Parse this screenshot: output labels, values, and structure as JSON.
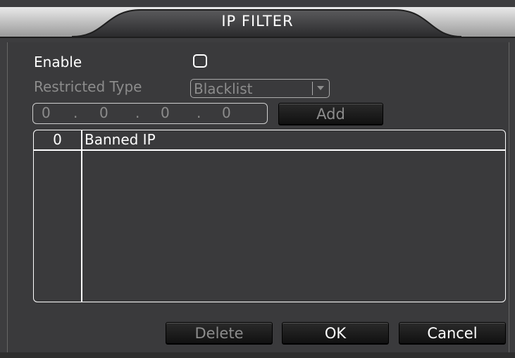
{
  "window": {
    "title": "IP FILTER"
  },
  "form": {
    "enable_label": "Enable",
    "enable_checked": false,
    "restricted_type_label": "Restricted Type",
    "restricted_type_value": "Blacklist",
    "ip_octets": [
      "0",
      "0",
      "0",
      "0"
    ],
    "ip_separator": ".",
    "add_label": "Add"
  },
  "table": {
    "columns": [
      "0",
      "Banned IP"
    ],
    "rows": []
  },
  "buttons": {
    "delete_label": "Delete",
    "ok_label": "OK",
    "cancel_label": "Cancel"
  }
}
